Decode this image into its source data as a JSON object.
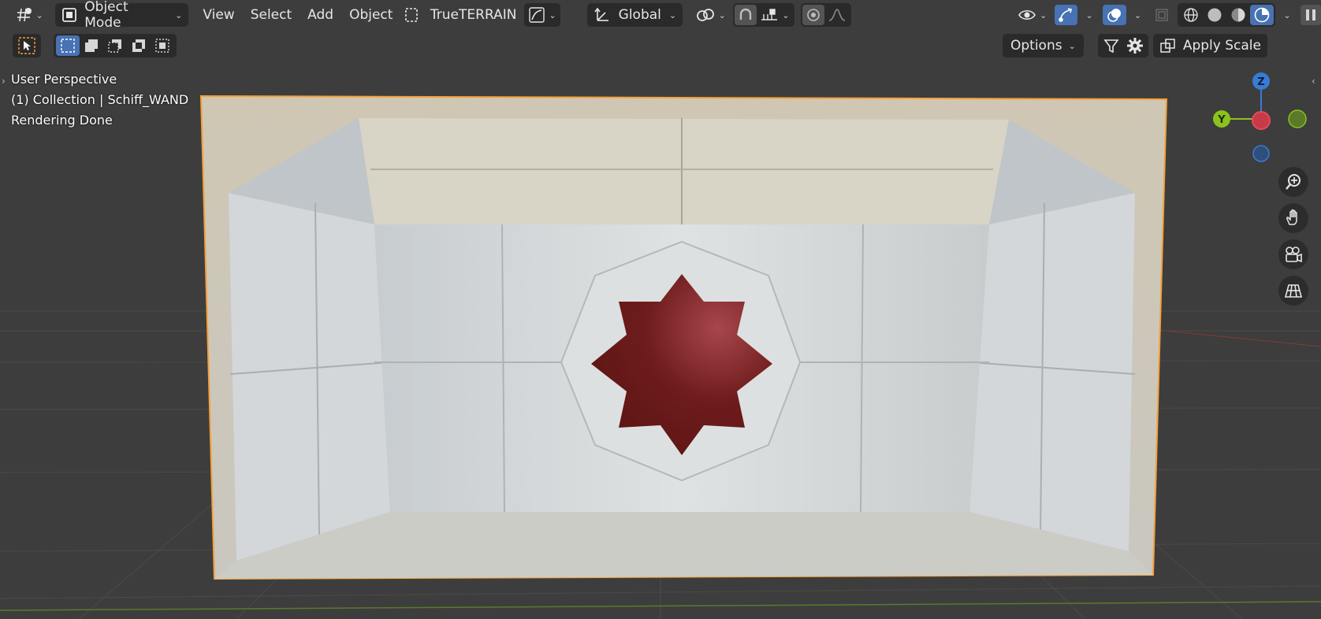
{
  "header": {
    "mode_label": "Object Mode",
    "menus": [
      "View",
      "Select",
      "Add",
      "Object"
    ],
    "addon_label": "TrueTERRAIN",
    "orientation_label": "Global"
  },
  "toolbar": {
    "options_label": "Options",
    "apply_scale_label": "Apply Scale"
  },
  "overlay": {
    "view_name": "User Perspective",
    "collection_info": "(1) Collection | Schiff_WAND",
    "status": "Rendering Done"
  },
  "gizmo": {
    "z_label": "Z",
    "y_label": "Y",
    "colors": {
      "x": "#e54a5a",
      "y": "#8bc21c",
      "z": "#3a7bd5"
    }
  },
  "colors": {
    "selection_outline": "#f5a03a",
    "active_button": "#4772b3",
    "star": "#7a1f1f",
    "cushion": "#d9dcd8"
  }
}
